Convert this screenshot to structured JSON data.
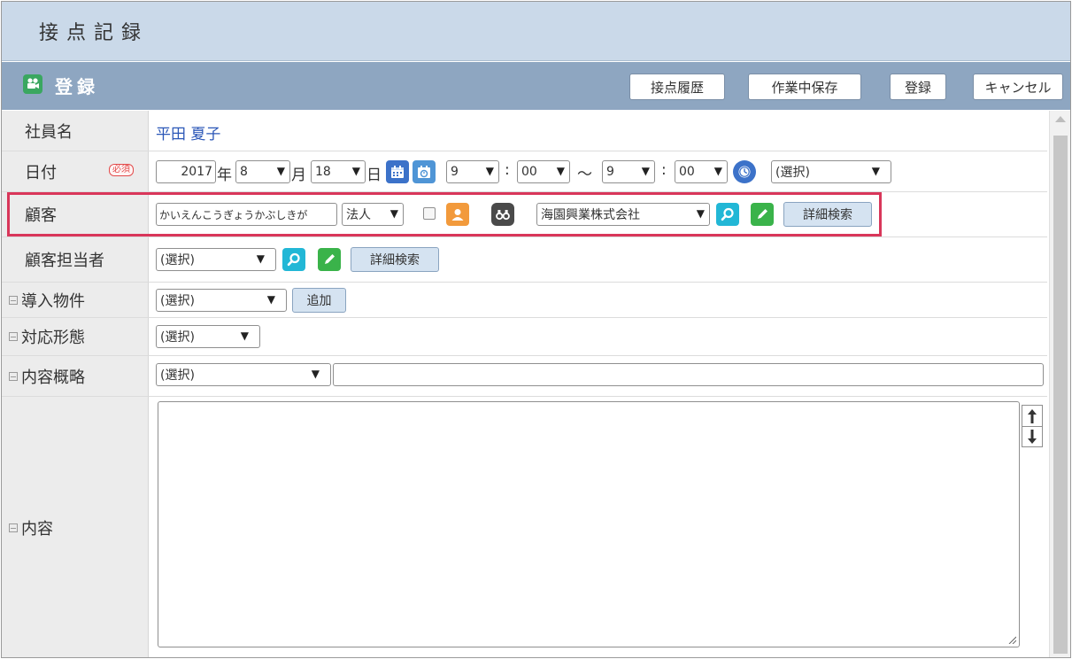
{
  "window": {
    "title": "接点記録"
  },
  "header": {
    "title": "登録",
    "buttons": {
      "history": "接点履歴",
      "save_wip": "作業中保存",
      "register": "登録",
      "cancel": "キャンセル"
    }
  },
  "rows": {
    "employee": {
      "label": "社員名",
      "value": "平田 夏子"
    },
    "date": {
      "label": "日付",
      "required_badge": "必須",
      "year": "2017",
      "year_suffix": "年",
      "month": "8",
      "month_suffix": "月",
      "day": "18",
      "day_suffix": "日",
      "start_hour": "9",
      "start_min": "00",
      "colon": ":",
      "tilde": "〜",
      "end_hour": "9",
      "end_min": "00",
      "preset": "(選択)"
    },
    "customer": {
      "label": "顧客",
      "kana_input": "かいえんこうぎょうかぶしきが",
      "type": "法人",
      "company": "海園興業株式会社",
      "detail_search": "詳細検索"
    },
    "contact": {
      "label": "顧客担当者",
      "value": "(選択)",
      "detail_search": "詳細検索"
    },
    "product": {
      "label": "導入物件",
      "value": "(選択)",
      "add": "追加"
    },
    "response": {
      "label": "対応形態",
      "value": "(選択)"
    },
    "summary": {
      "label": "内容概略",
      "value": "(選択)",
      "text": ""
    },
    "content": {
      "label": "内容",
      "text": ""
    }
  },
  "icons": {
    "register": "video-camera-icon",
    "calendar": "calendar-icon",
    "clock": "clock-icon",
    "person": "person-icon",
    "binoculars": "binoculars-icon",
    "search": "search-icon",
    "edit": "pencil-icon"
  },
  "colors": {
    "titlebar": "#cad9e9",
    "headerbar": "#8ea6c1",
    "highlight": "#d9365a",
    "search_icon": "#22b7d6",
    "edit_icon": "#3ab34a",
    "person_icon": "#f29a3c"
  }
}
